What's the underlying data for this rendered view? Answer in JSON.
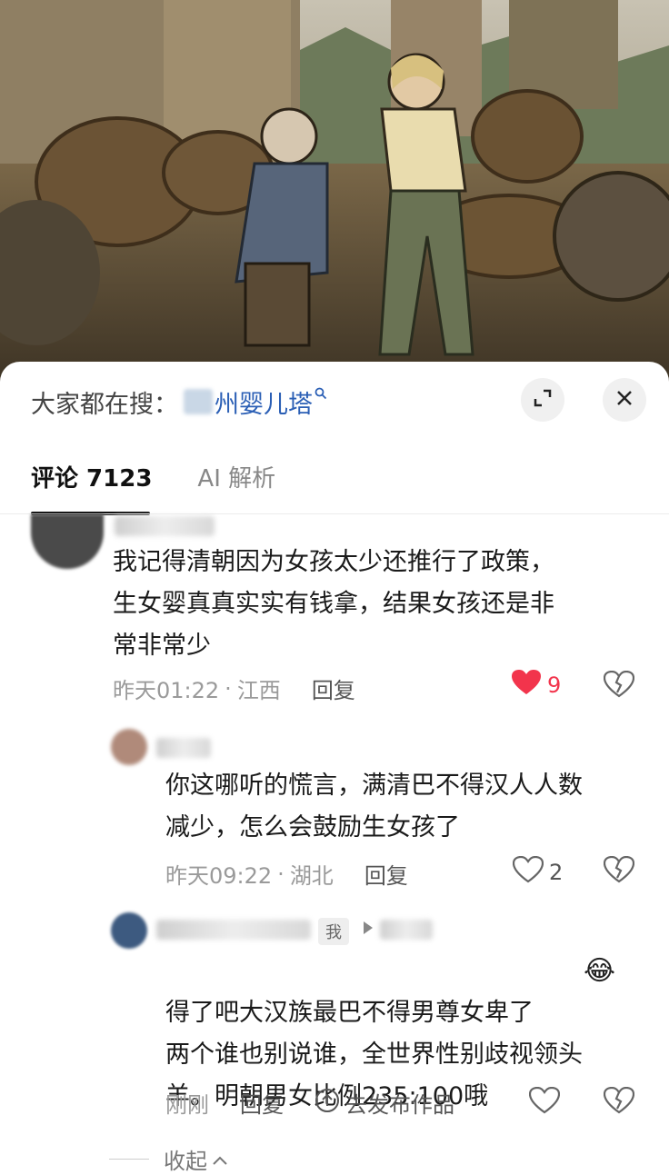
{
  "colors": {
    "accent_search": "#2b5fb5",
    "like_red": "#f2344c",
    "meta_gray": "#9a9a9a"
  },
  "hero": {
    "image": "illustration-old-woman-and-young-woman-ruins"
  },
  "search": {
    "prefix": "大家都在搜：",
    "term": "州婴儿塔",
    "icon": "search-icon"
  },
  "tabs": [
    {
      "label": "评论 7123",
      "active": true
    },
    {
      "label": "AI 解析",
      "active": false
    }
  ],
  "comments": [
    {
      "text": "我记得清朝因为女孩太少还推行了政策，\n生女婴真真实实有钱拿，结果女孩还是非\n常非常少",
      "time": "昨天01:22",
      "location": "江西",
      "reply_label": "回复",
      "likes": "9",
      "liked": true
    },
    {
      "text": "你这哪听的慌言，满清巴不得汉人人数\n减少，怎么会鼓励生女孩了",
      "time": "昨天09:22",
      "location": "湖北",
      "reply_label": "回复",
      "likes": "2",
      "liked": false
    },
    {
      "me_badge": "我",
      "text": "得了吧大汉族最巴不得男尊女卑了\n两个谁也别说谁，全世界性别歧视领头\n羊。明朝男女比例235:100哦",
      "emoji": "😂",
      "time": "刚刚",
      "reply_label": "回复",
      "publish_label": "去发布作品",
      "liked": false
    }
  ],
  "collapse_label": "收起"
}
